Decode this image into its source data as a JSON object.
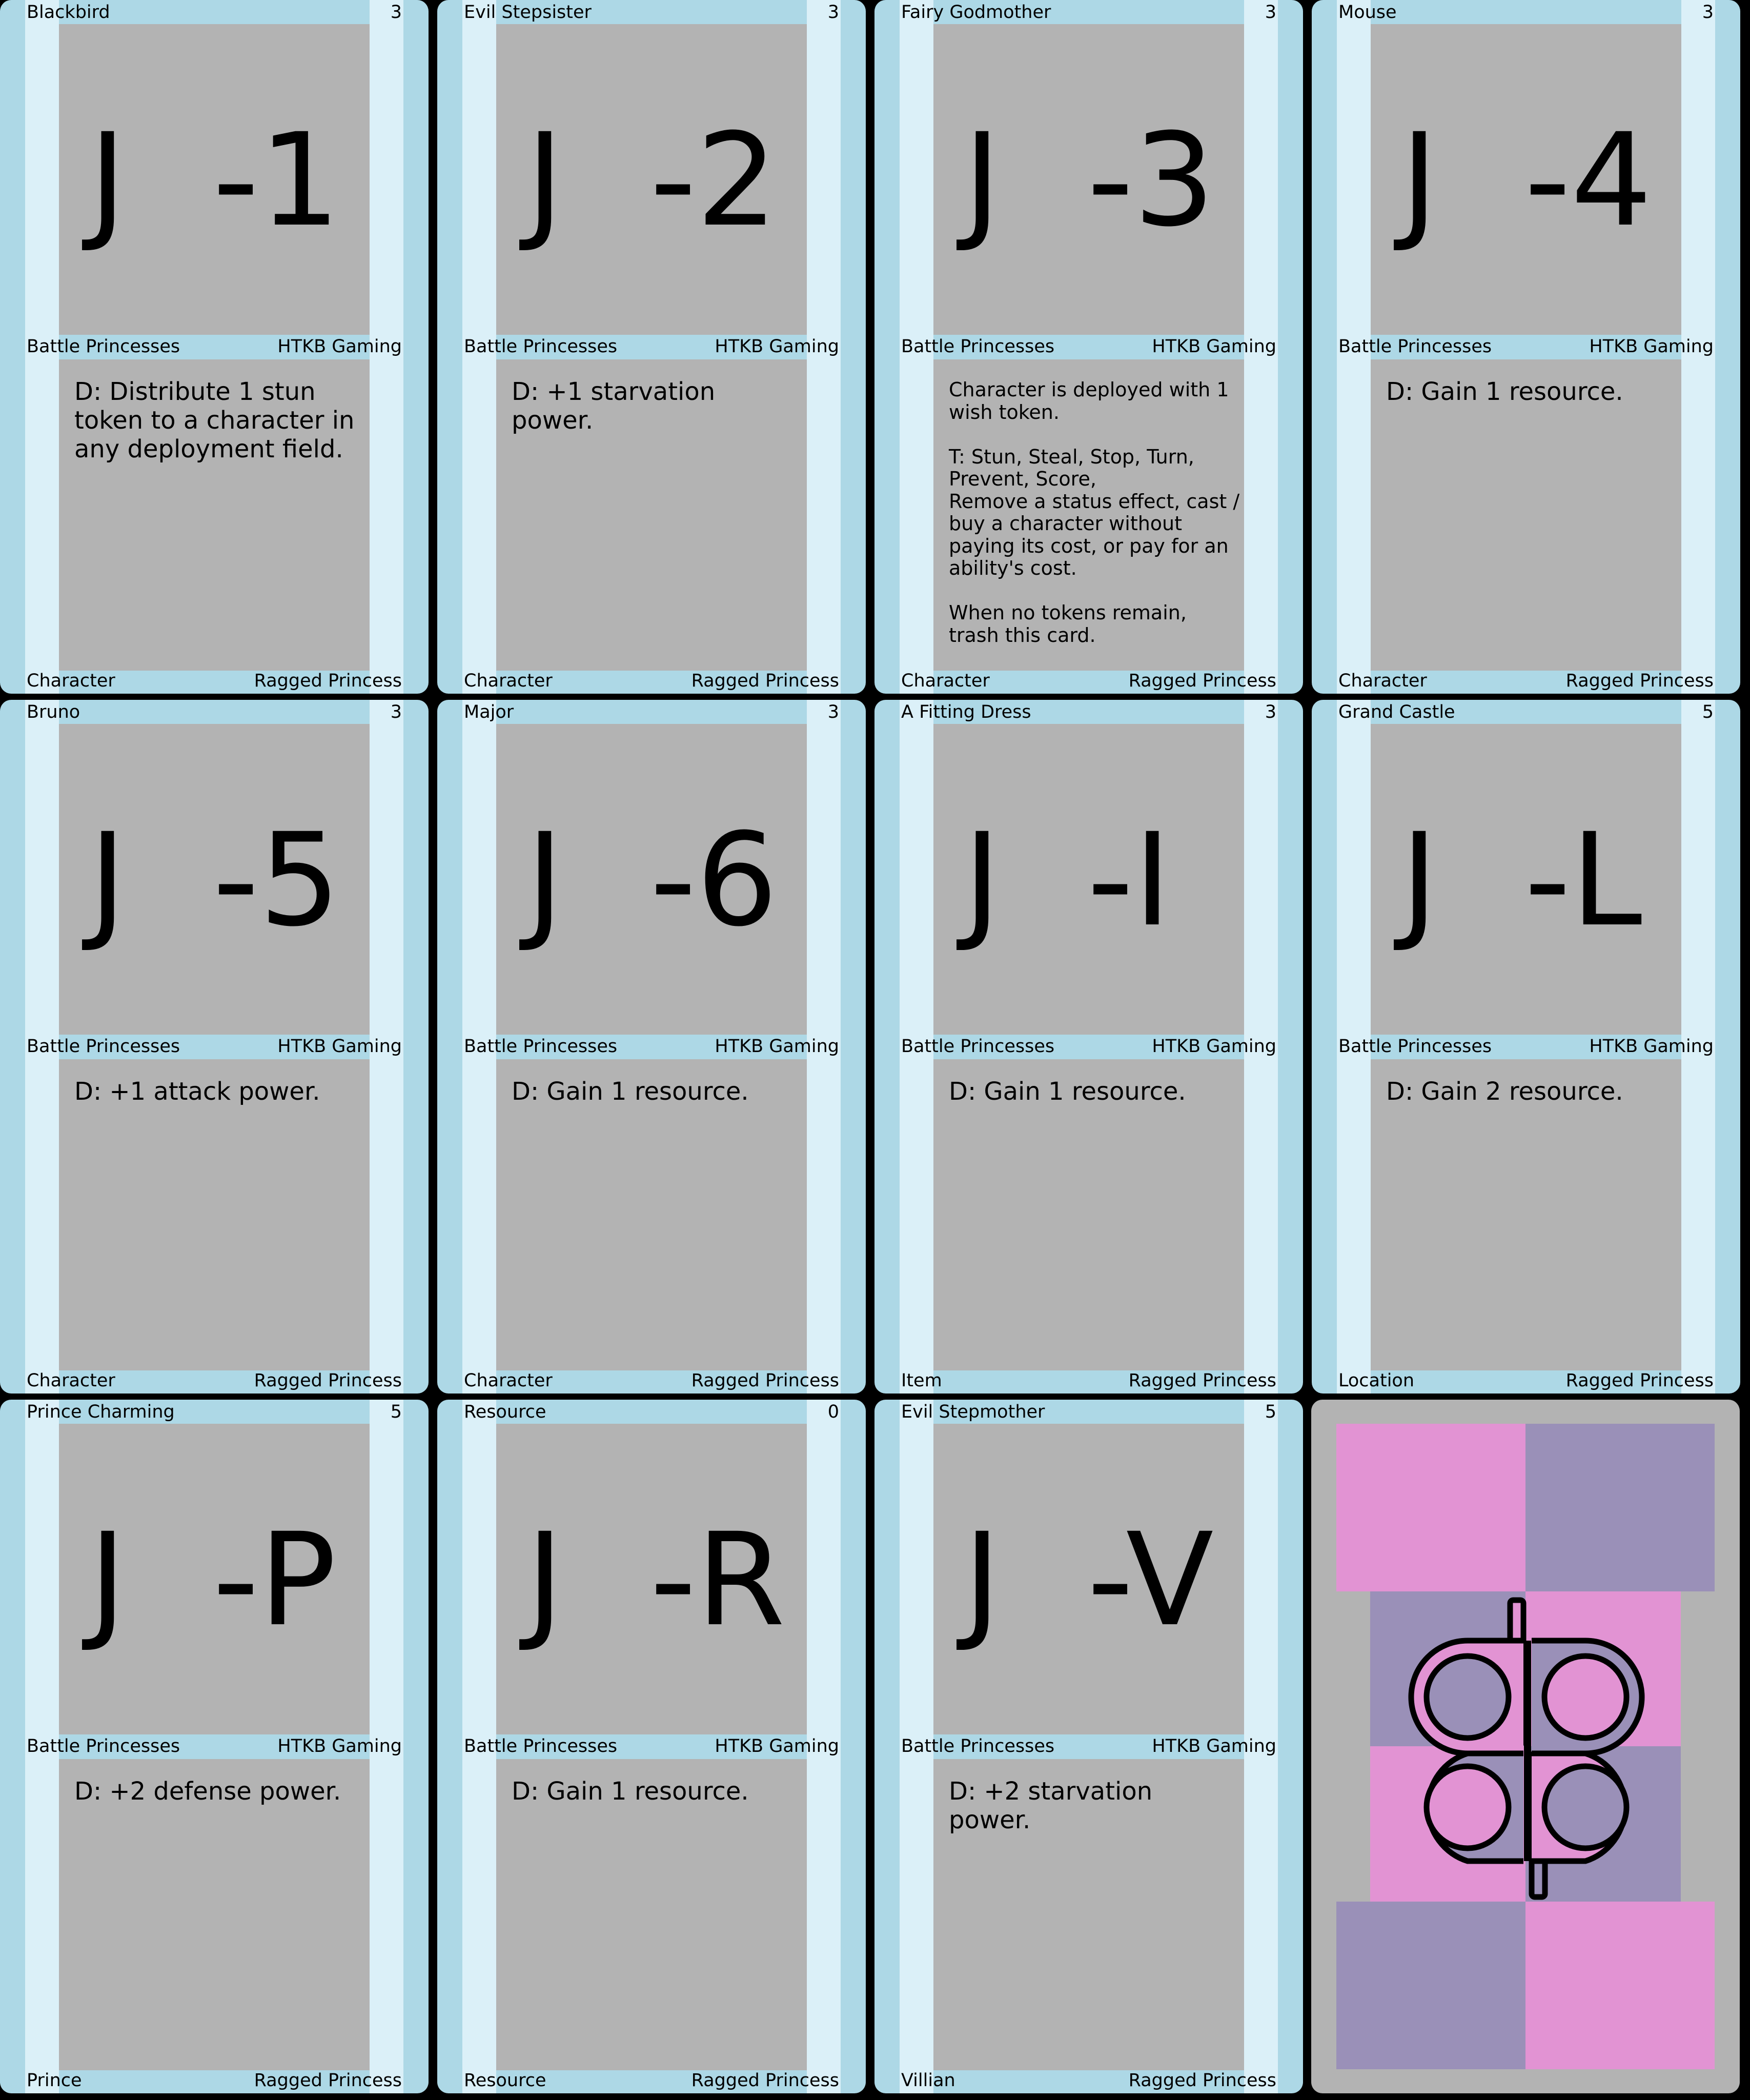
{
  "sheet": {
    "cards": [
      {
        "title": "Blackbird",
        "cost": "3",
        "code_letter": "J",
        "code_number": "-1",
        "set": "Battle Princesses",
        "publisher": "HTKB Gaming",
        "ability": "D: Distribute 1 stun token to a character in any deployment field.",
        "type": "Character",
        "faction": "Ragged Princess"
      },
      {
        "title": "Evil Stepsister",
        "cost": "3",
        "code_letter": "J",
        "code_number": "-2",
        "set": "Battle Princesses",
        "publisher": "HTKB Gaming",
        "ability": "D: +1 starvation power.",
        "type": "Character",
        "faction": "Ragged Princess"
      },
      {
        "title": "Fairy Godmother",
        "cost": "3",
        "code_letter": "J",
        "code_number": "-3",
        "set": "Battle Princesses",
        "publisher": "HTKB Gaming",
        "ability": "Character is deployed with 1 wish token.\n\nT: Stun, Steal, Stop, Turn, Prevent, Score,\nRemove a status effect, cast / buy a character without paying its cost, or pay for an ability's cost.\n\nWhen no tokens remain, trash this card.",
        "type": "Character",
        "faction": "Ragged Princess"
      },
      {
        "title": "Mouse",
        "cost": "3",
        "code_letter": "J",
        "code_number": "-4",
        "set": "Battle Princesses",
        "publisher": "HTKB Gaming",
        "ability": "D: Gain 1 resource.",
        "type": "Character",
        "faction": "Ragged Princess"
      },
      {
        "title": "Bruno",
        "cost": "3",
        "code_letter": "J",
        "code_number": "-5",
        "set": "Battle Princesses",
        "publisher": "HTKB Gaming",
        "ability": "D: +1 attack power.",
        "type": "Character",
        "faction": "Ragged Princess"
      },
      {
        "title": "Major",
        "cost": "3",
        "code_letter": "J",
        "code_number": "-6",
        "set": "Battle Princesses",
        "publisher": "HTKB Gaming",
        "ability": "D: Gain 1 resource.",
        "type": "Character",
        "faction": "Ragged Princess"
      },
      {
        "title": "A Fitting Dress",
        "cost": "3",
        "code_letter": "J",
        "code_number": "-I",
        "set": "Battle Princesses",
        "publisher": "HTKB Gaming",
        "ability": "D: Gain 1 resource.",
        "type": "Item",
        "faction": "Ragged Princess"
      },
      {
        "title": "Grand Castle",
        "cost": "5",
        "code_letter": "J",
        "code_number": "-L",
        "set": "Battle Princesses",
        "publisher": "HTKB Gaming",
        "ability": "D: Gain 2 resource.",
        "type": "Location",
        "faction": "Ragged Princess"
      },
      {
        "title": "Prince Charming",
        "cost": "5",
        "code_letter": "J",
        "code_number": "-P",
        "set": "Battle Princesses",
        "publisher": "HTKB Gaming",
        "ability": "D: +2 defense power.",
        "type": "Prince",
        "faction": "Ragged Princess"
      },
      {
        "title": "Resource",
        "cost": "0",
        "code_letter": "J",
        "code_number": "-R",
        "set": "Battle Princesses",
        "publisher": "HTKB Gaming",
        "ability": "D: Gain 1 resource.",
        "type": "Resource",
        "faction": "Ragged Princess"
      },
      {
        "title": "Evil Stepmother",
        "cost": "5",
        "code_letter": "J",
        "code_number": "-V",
        "set": "Battle Princesses",
        "publisher": "HTKB Gaming",
        "ability": "D: +2 starvation power.",
        "type": "Villian",
        "faction": "Ragged Princess"
      }
    ],
    "card_back": {
      "icon": "htkb-logo-icon",
      "colors": {
        "pink": "#e293d3",
        "purple": "#9a90b8",
        "gray": "#b3b3b3"
      }
    }
  },
  "colors": {
    "card_frame": "#add8e6",
    "card_stripe": "#dbf0f8",
    "card_panel": "#b3b3b3",
    "background": "#000000"
  }
}
